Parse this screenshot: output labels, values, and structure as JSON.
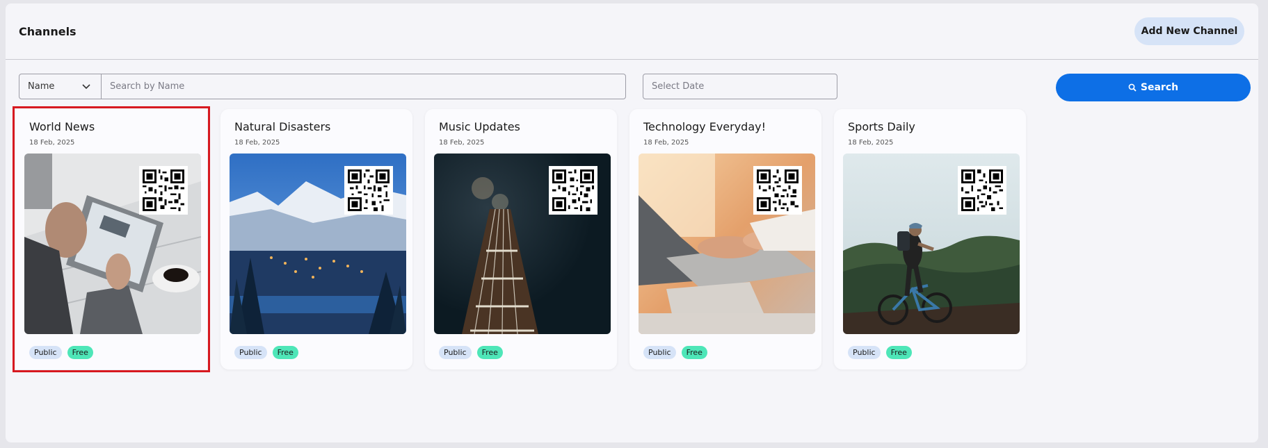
{
  "header": {
    "title": "Channels",
    "add_button_label": "Add New Channel"
  },
  "filters": {
    "field_select_value": "Name",
    "search_placeholder": "Search by Name",
    "date_placeholder": "Select Date",
    "search_button_label": "Search"
  },
  "channels": [
    {
      "title": "World News",
      "date": "18 Feb, 2025",
      "visibility": "Public",
      "price": "Free",
      "selected": true
    },
    {
      "title": "Natural Disasters",
      "date": "18 Feb, 2025",
      "visibility": "Public",
      "price": "Free",
      "selected": false
    },
    {
      "title": "Music Updates",
      "date": "18 Feb, 2025",
      "visibility": "Public",
      "price": "Free",
      "selected": false
    },
    {
      "title": "Technology Everyday!",
      "date": "18 Feb, 2025",
      "visibility": "Public",
      "price": "Free",
      "selected": false
    },
    {
      "title": "Sports Daily",
      "date": "18 Feb, 2025",
      "visibility": "Public",
      "price": "Free",
      "selected": false
    }
  ],
  "colors": {
    "primary": "#0d6fe6",
    "public_badge": "#d6e3f7",
    "free_badge": "#4ee6b8",
    "selection_outline": "#d71920"
  },
  "icons": {
    "select_chevron": "chevron-down-icon",
    "search_button": "search-icon",
    "card_code": "qr-code-icon"
  }
}
